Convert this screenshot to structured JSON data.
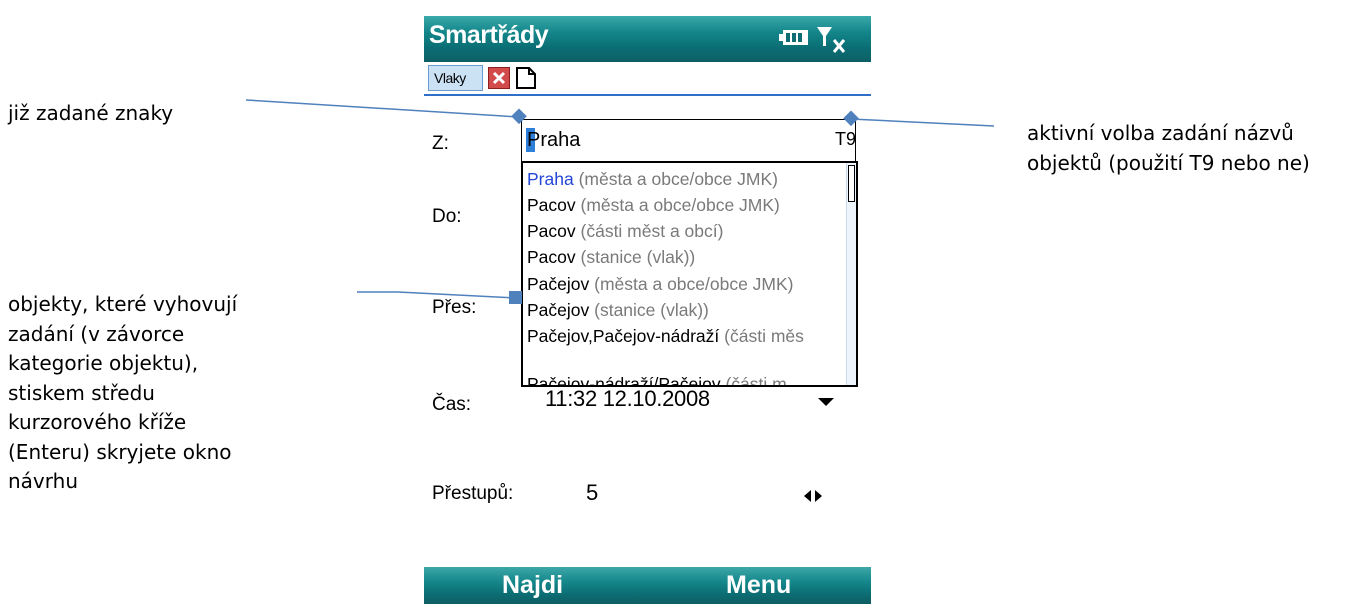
{
  "app": {
    "title": "Smartřády",
    "battery_icon": "battery-icon",
    "signal_icon": "signal-no-service-icon"
  },
  "tabs": {
    "active_label": "Vlaky",
    "close_icon": "close-tab-icon",
    "new_icon": "new-document-icon"
  },
  "form": {
    "from_label": "Z:",
    "from_value": "Praha",
    "t9_indicator": "T9",
    "to_label": "Do:",
    "via_label": "Přes:",
    "time_label": "Čas:",
    "time_value": "11:32  12.10.2008",
    "transfers_label": "Přestupů:",
    "transfers_value": "5"
  },
  "suggestions": [
    {
      "name": "Praha",
      "category": " (města a obce/obce JMK)",
      "selected": true
    },
    {
      "name": "Pacov",
      "category": " (města a obce/obce JMK)",
      "selected": false
    },
    {
      "name": "Pacov",
      "category": " (části měst a obcí)",
      "selected": false
    },
    {
      "name": "Pacov",
      "category": " (stanice (vlak))",
      "selected": false
    },
    {
      "name": "Pačejov",
      "category": " (města a obce/obce JMK)",
      "selected": false
    },
    {
      "name": "Pačejov",
      "category": " (stanice (vlak))",
      "selected": false
    },
    {
      "name": "Pačejov,Pačejov-nádraží",
      "category": " (části měs",
      "selected": false
    },
    {
      "name": "Pačejov-nádraží/Pačejov",
      "category": " (části m",
      "selected": false
    }
  ],
  "softkeys": {
    "left": "Najdi",
    "right": "Menu"
  },
  "annotations": {
    "entered_chars": "již zadané znaky",
    "matching_objects": [
      "objekty, které vyhovují",
      "zadání (v závorce",
      "kategorie objektu),",
      "stiskem středu",
      "kurzorového kříže",
      "(Enteru) skryjete okno",
      "návrhu"
    ],
    "active_input_mode": [
      "aktivní volba zadání názvů",
      "objektů (použití T9 nebo ne)"
    ]
  },
  "colors": {
    "title_bar": "#13868a",
    "selection_text": "#2447d8",
    "category_text": "#7a7a7a",
    "callout_line": "#4f81bd"
  }
}
